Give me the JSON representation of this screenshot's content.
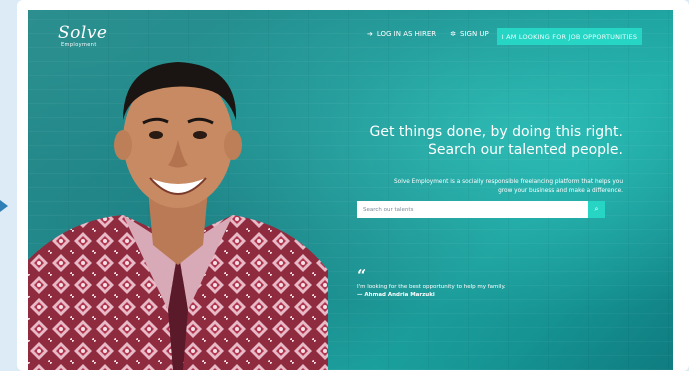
{
  "brand": {
    "name": "Solve",
    "subtitle": "Employment"
  },
  "nav": {
    "login_label": "LOG IN AS HIRER",
    "signup_label": "SIGN UP",
    "cta_label": "I AM LOOKING FOR JOB OPPORTUNITIES"
  },
  "hero": {
    "headline_line1": "Get things done, by doing this right.",
    "headline_line2": "Search our talented people.",
    "desc_line1": "Solve Employment is a socially responsible freelancing platform that helps you",
    "desc_line2": "grow your business and make a difference."
  },
  "search": {
    "placeholder": "Search our talents"
  },
  "quote": {
    "text": "I'm looking for the best opportunity to help my family.",
    "author": "— Ahmad Andria Marzuki"
  },
  "colors": {
    "accent": "#27d5c5",
    "hero_bg": "#1f8f90"
  }
}
